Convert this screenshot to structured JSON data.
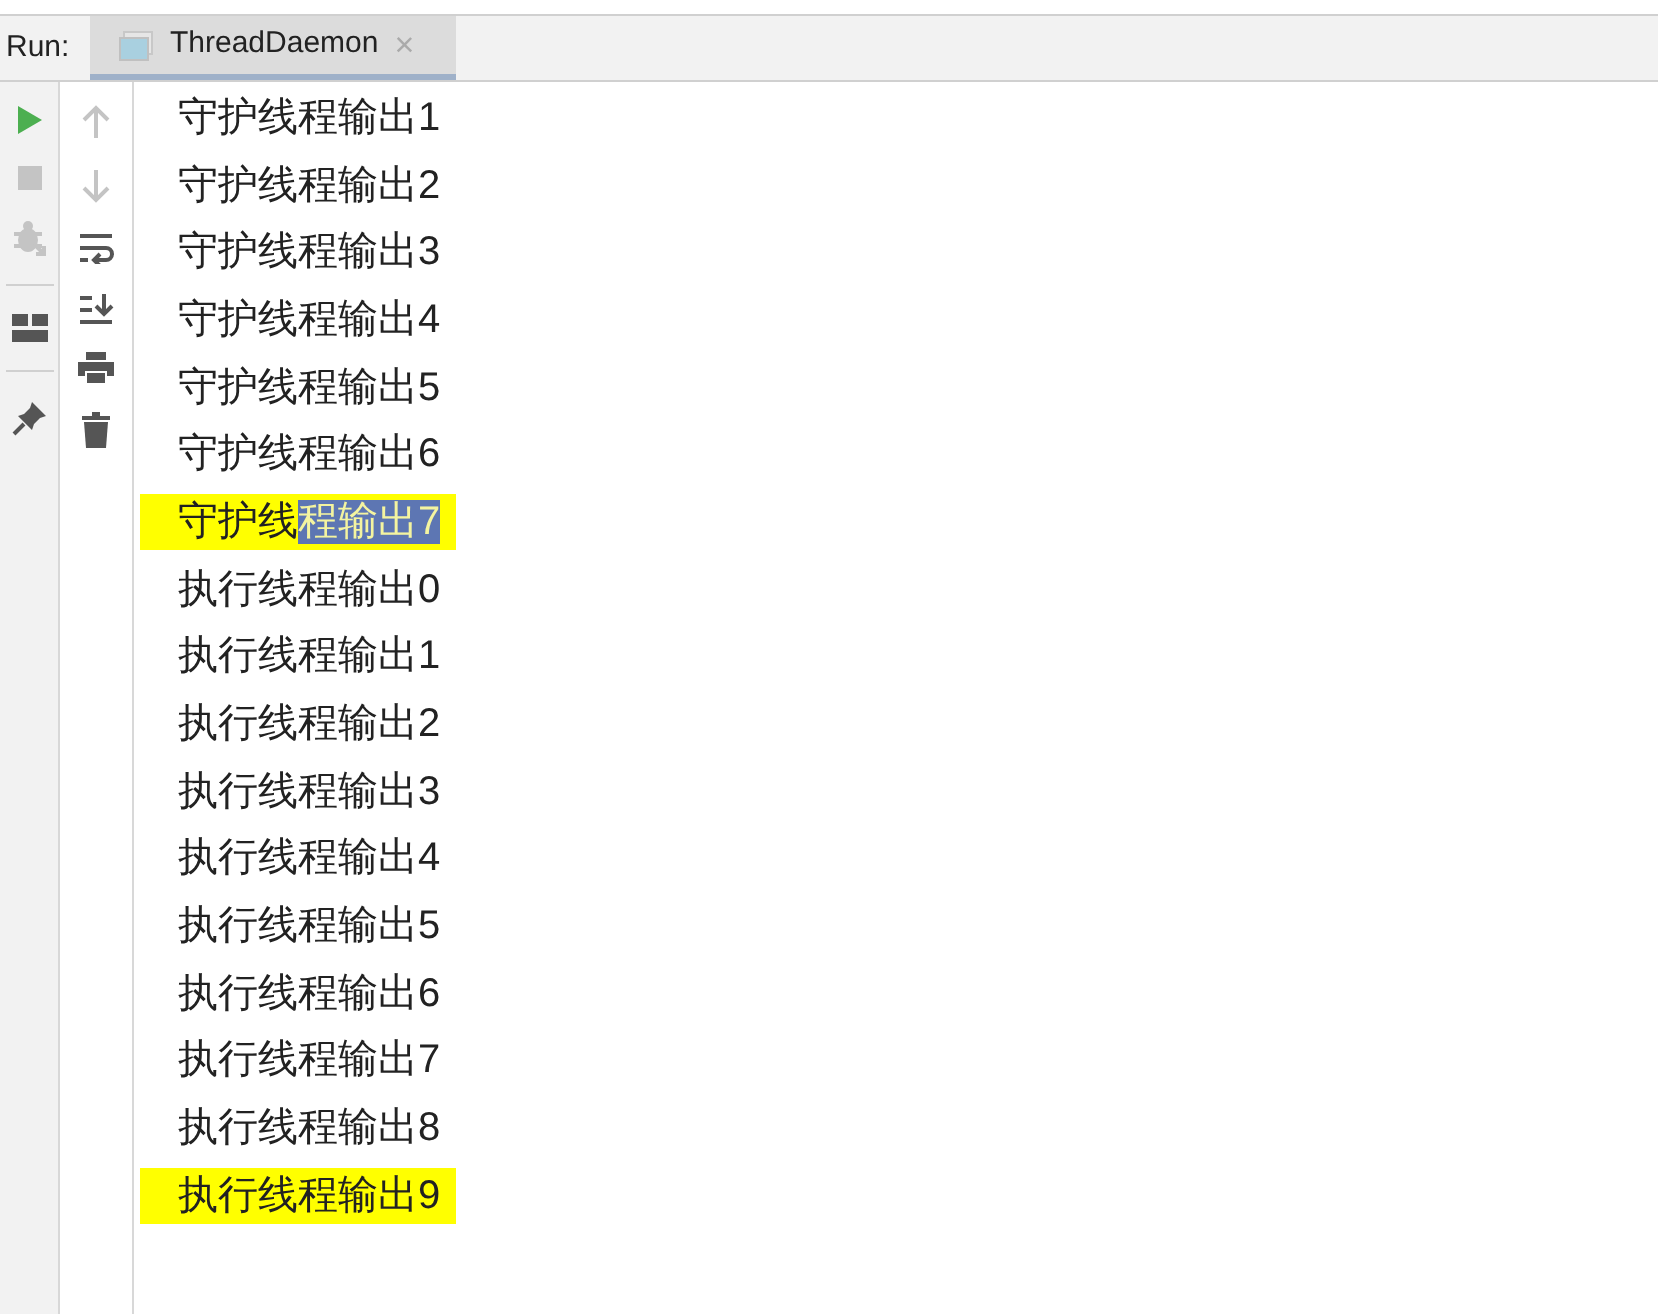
{
  "run_label": "Run:",
  "tab": {
    "title": "ThreadDaemon",
    "selected": true,
    "close": "×"
  },
  "lines": [
    {
      "text": "守护线程输出1",
      "highlighted": false
    },
    {
      "text": "守护线程输出2",
      "highlighted": false
    },
    {
      "text": "守护线程输出3",
      "highlighted": false
    },
    {
      "text": "守护线程输出4",
      "highlighted": false
    },
    {
      "text": "守护线程输出5",
      "highlighted": false
    },
    {
      "text": "守护线程输出6",
      "highlighted": false
    },
    {
      "text": "守护线",
      "selected_text": "程输出7",
      "highlighted": true
    },
    {
      "text": "执行线程输出0",
      "highlighted": false
    },
    {
      "text": "执行线程输出1",
      "highlighted": false
    },
    {
      "text": "执行线程输出2",
      "highlighted": false
    },
    {
      "text": "执行线程输出3",
      "highlighted": false
    },
    {
      "text": "执行线程输出4",
      "highlighted": false
    },
    {
      "text": "执行线程输出5",
      "highlighted": false
    },
    {
      "text": "执行线程输出6",
      "highlighted": false
    },
    {
      "text": "执行线程输出7",
      "highlighted": false
    },
    {
      "text": "执行线程输出8",
      "highlighted": false
    },
    {
      "text": "执行线程输出9",
      "highlighted": true
    }
  ]
}
